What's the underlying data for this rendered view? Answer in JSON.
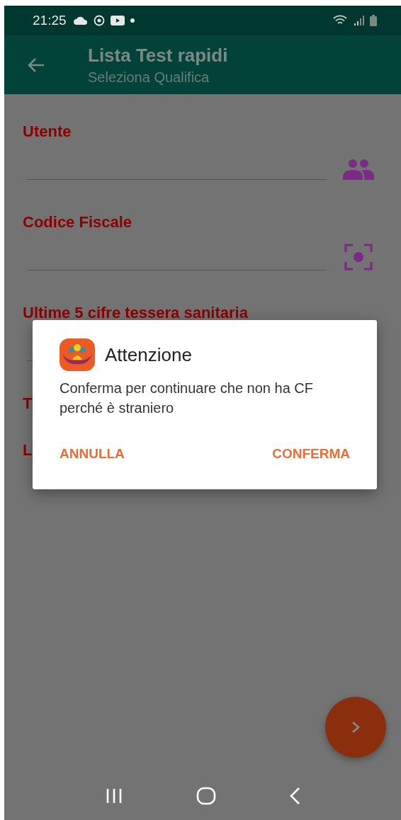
{
  "status_bar": {
    "time": "21:25"
  },
  "app_bar": {
    "title": "Lista Test rapidi",
    "subtitle": "Seleziona Qualifica"
  },
  "fields": [
    {
      "label": "Utente",
      "kind": "picker"
    },
    {
      "label": "Codice Fiscale",
      "kind": "scanner"
    },
    {
      "label": "Ultime 5 cifre tessera sanitaria",
      "kind": "input"
    },
    {
      "label": "T",
      "kind": "label"
    },
    {
      "label": "L",
      "kind": "label"
    }
  ],
  "dialog": {
    "title": "Attenzione",
    "message": "Conferma per continuare che non ha CF perché è straniero",
    "buttons": [
      "ANNULLA",
      "CONFERMA"
    ]
  }
}
